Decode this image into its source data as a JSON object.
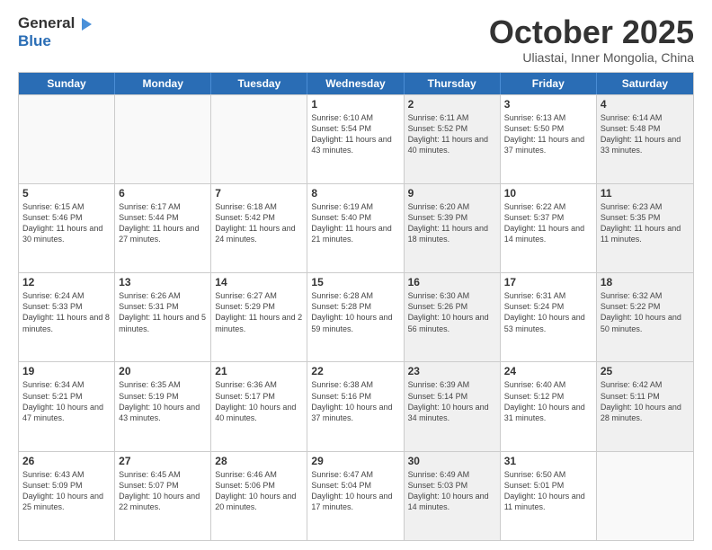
{
  "logo": {
    "line1": "General",
    "line2": "Blue"
  },
  "header": {
    "month": "October 2025",
    "location": "Uliastai, Inner Mongolia, China"
  },
  "weekdays": [
    "Sunday",
    "Monday",
    "Tuesday",
    "Wednesday",
    "Thursday",
    "Friday",
    "Saturday"
  ],
  "rows": [
    [
      {
        "day": "",
        "sunrise": "",
        "sunset": "",
        "daylight": "",
        "shaded": false,
        "empty": true
      },
      {
        "day": "",
        "sunrise": "",
        "sunset": "",
        "daylight": "",
        "shaded": false,
        "empty": true
      },
      {
        "day": "",
        "sunrise": "",
        "sunset": "",
        "daylight": "",
        "shaded": false,
        "empty": true
      },
      {
        "day": "1",
        "sunrise": "Sunrise: 6:10 AM",
        "sunset": "Sunset: 5:54 PM",
        "daylight": "Daylight: 11 hours and 43 minutes.",
        "shaded": false,
        "empty": false
      },
      {
        "day": "2",
        "sunrise": "Sunrise: 6:11 AM",
        "sunset": "Sunset: 5:52 PM",
        "daylight": "Daylight: 11 hours and 40 minutes.",
        "shaded": true,
        "empty": false
      },
      {
        "day": "3",
        "sunrise": "Sunrise: 6:13 AM",
        "sunset": "Sunset: 5:50 PM",
        "daylight": "Daylight: 11 hours and 37 minutes.",
        "shaded": false,
        "empty": false
      },
      {
        "day": "4",
        "sunrise": "Sunrise: 6:14 AM",
        "sunset": "Sunset: 5:48 PM",
        "daylight": "Daylight: 11 hours and 33 minutes.",
        "shaded": true,
        "empty": false
      }
    ],
    [
      {
        "day": "5",
        "sunrise": "Sunrise: 6:15 AM",
        "sunset": "Sunset: 5:46 PM",
        "daylight": "Daylight: 11 hours and 30 minutes.",
        "shaded": false,
        "empty": false
      },
      {
        "day": "6",
        "sunrise": "Sunrise: 6:17 AM",
        "sunset": "Sunset: 5:44 PM",
        "daylight": "Daylight: 11 hours and 27 minutes.",
        "shaded": false,
        "empty": false
      },
      {
        "day": "7",
        "sunrise": "Sunrise: 6:18 AM",
        "sunset": "Sunset: 5:42 PM",
        "daylight": "Daylight: 11 hours and 24 minutes.",
        "shaded": false,
        "empty": false
      },
      {
        "day": "8",
        "sunrise": "Sunrise: 6:19 AM",
        "sunset": "Sunset: 5:40 PM",
        "daylight": "Daylight: 11 hours and 21 minutes.",
        "shaded": false,
        "empty": false
      },
      {
        "day": "9",
        "sunrise": "Sunrise: 6:20 AM",
        "sunset": "Sunset: 5:39 PM",
        "daylight": "Daylight: 11 hours and 18 minutes.",
        "shaded": true,
        "empty": false
      },
      {
        "day": "10",
        "sunrise": "Sunrise: 6:22 AM",
        "sunset": "Sunset: 5:37 PM",
        "daylight": "Daylight: 11 hours and 14 minutes.",
        "shaded": false,
        "empty": false
      },
      {
        "day": "11",
        "sunrise": "Sunrise: 6:23 AM",
        "sunset": "Sunset: 5:35 PM",
        "daylight": "Daylight: 11 hours and 11 minutes.",
        "shaded": true,
        "empty": false
      }
    ],
    [
      {
        "day": "12",
        "sunrise": "Sunrise: 6:24 AM",
        "sunset": "Sunset: 5:33 PM",
        "daylight": "Daylight: 11 hours and 8 minutes.",
        "shaded": false,
        "empty": false
      },
      {
        "day": "13",
        "sunrise": "Sunrise: 6:26 AM",
        "sunset": "Sunset: 5:31 PM",
        "daylight": "Daylight: 11 hours and 5 minutes.",
        "shaded": false,
        "empty": false
      },
      {
        "day": "14",
        "sunrise": "Sunrise: 6:27 AM",
        "sunset": "Sunset: 5:29 PM",
        "daylight": "Daylight: 11 hours and 2 minutes.",
        "shaded": false,
        "empty": false
      },
      {
        "day": "15",
        "sunrise": "Sunrise: 6:28 AM",
        "sunset": "Sunset: 5:28 PM",
        "daylight": "Daylight: 10 hours and 59 minutes.",
        "shaded": false,
        "empty": false
      },
      {
        "day": "16",
        "sunrise": "Sunrise: 6:30 AM",
        "sunset": "Sunset: 5:26 PM",
        "daylight": "Daylight: 10 hours and 56 minutes.",
        "shaded": true,
        "empty": false
      },
      {
        "day": "17",
        "sunrise": "Sunrise: 6:31 AM",
        "sunset": "Sunset: 5:24 PM",
        "daylight": "Daylight: 10 hours and 53 minutes.",
        "shaded": false,
        "empty": false
      },
      {
        "day": "18",
        "sunrise": "Sunrise: 6:32 AM",
        "sunset": "Sunset: 5:22 PM",
        "daylight": "Daylight: 10 hours and 50 minutes.",
        "shaded": true,
        "empty": false
      }
    ],
    [
      {
        "day": "19",
        "sunrise": "Sunrise: 6:34 AM",
        "sunset": "Sunset: 5:21 PM",
        "daylight": "Daylight: 10 hours and 47 minutes.",
        "shaded": false,
        "empty": false
      },
      {
        "day": "20",
        "sunrise": "Sunrise: 6:35 AM",
        "sunset": "Sunset: 5:19 PM",
        "daylight": "Daylight: 10 hours and 43 minutes.",
        "shaded": false,
        "empty": false
      },
      {
        "day": "21",
        "sunrise": "Sunrise: 6:36 AM",
        "sunset": "Sunset: 5:17 PM",
        "daylight": "Daylight: 10 hours and 40 minutes.",
        "shaded": false,
        "empty": false
      },
      {
        "day": "22",
        "sunrise": "Sunrise: 6:38 AM",
        "sunset": "Sunset: 5:16 PM",
        "daylight": "Daylight: 10 hours and 37 minutes.",
        "shaded": false,
        "empty": false
      },
      {
        "day": "23",
        "sunrise": "Sunrise: 6:39 AM",
        "sunset": "Sunset: 5:14 PM",
        "daylight": "Daylight: 10 hours and 34 minutes.",
        "shaded": true,
        "empty": false
      },
      {
        "day": "24",
        "sunrise": "Sunrise: 6:40 AM",
        "sunset": "Sunset: 5:12 PM",
        "daylight": "Daylight: 10 hours and 31 minutes.",
        "shaded": false,
        "empty": false
      },
      {
        "day": "25",
        "sunrise": "Sunrise: 6:42 AM",
        "sunset": "Sunset: 5:11 PM",
        "daylight": "Daylight: 10 hours and 28 minutes.",
        "shaded": true,
        "empty": false
      }
    ],
    [
      {
        "day": "26",
        "sunrise": "Sunrise: 6:43 AM",
        "sunset": "Sunset: 5:09 PM",
        "daylight": "Daylight: 10 hours and 25 minutes.",
        "shaded": false,
        "empty": false
      },
      {
        "day": "27",
        "sunrise": "Sunrise: 6:45 AM",
        "sunset": "Sunset: 5:07 PM",
        "daylight": "Daylight: 10 hours and 22 minutes.",
        "shaded": false,
        "empty": false
      },
      {
        "day": "28",
        "sunrise": "Sunrise: 6:46 AM",
        "sunset": "Sunset: 5:06 PM",
        "daylight": "Daylight: 10 hours and 20 minutes.",
        "shaded": false,
        "empty": false
      },
      {
        "day": "29",
        "sunrise": "Sunrise: 6:47 AM",
        "sunset": "Sunset: 5:04 PM",
        "daylight": "Daylight: 10 hours and 17 minutes.",
        "shaded": false,
        "empty": false
      },
      {
        "day": "30",
        "sunrise": "Sunrise: 6:49 AM",
        "sunset": "Sunset: 5:03 PM",
        "daylight": "Daylight: 10 hours and 14 minutes.",
        "shaded": true,
        "empty": false
      },
      {
        "day": "31",
        "sunrise": "Sunrise: 6:50 AM",
        "sunset": "Sunset: 5:01 PM",
        "daylight": "Daylight: 10 hours and 11 minutes.",
        "shaded": false,
        "empty": false
      },
      {
        "day": "",
        "sunrise": "",
        "sunset": "",
        "daylight": "",
        "shaded": true,
        "empty": true
      }
    ]
  ]
}
